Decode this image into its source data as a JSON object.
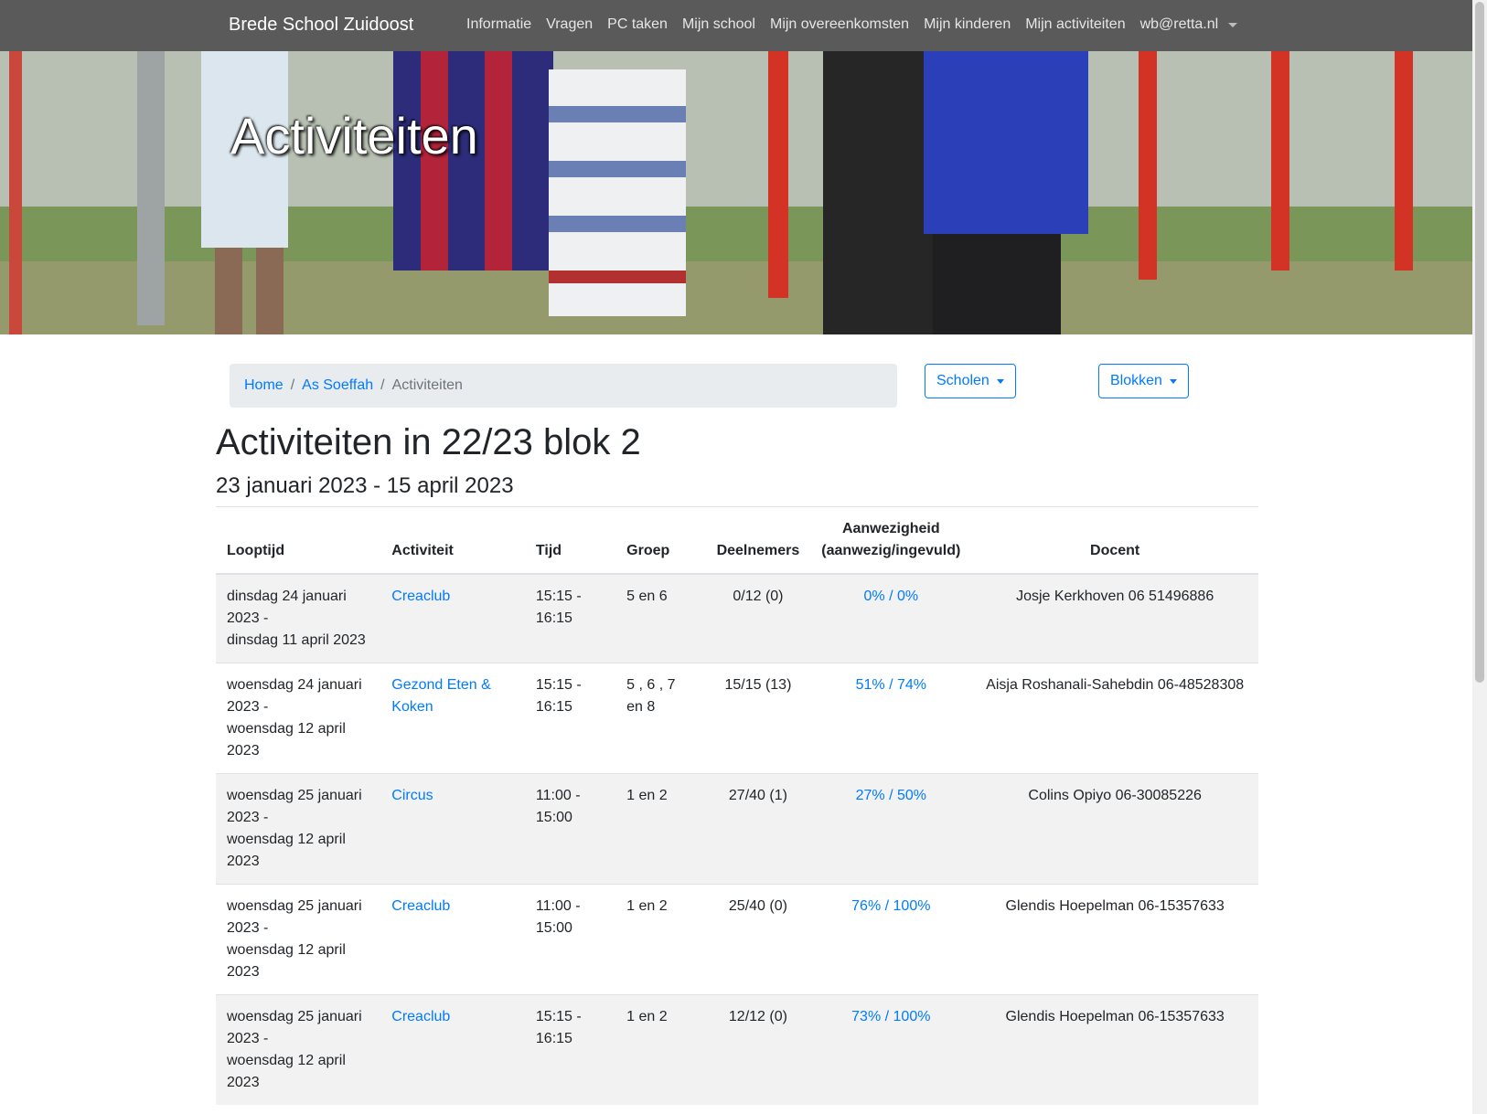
{
  "navbar": {
    "brand": "Brede School Zuidoost",
    "items": [
      "Informatie",
      "Vragen",
      "PC taken",
      "Mijn school",
      "Mijn overeenkomsten",
      "Mijn kinderen",
      "Mijn activiteiten",
      "wb@retta.nl"
    ]
  },
  "hero": {
    "title": "Activiteiten"
  },
  "breadcrumb": {
    "home": "Home",
    "school": "As Soeffah",
    "current": "Activiteiten"
  },
  "buttons": {
    "schools": "Scholen",
    "blocks": "Blokken"
  },
  "page": {
    "title": "Activiteiten in 22/23 blok 2",
    "subtitle": "23 januari 2023 - 15 april 2023"
  },
  "table": {
    "headers": {
      "looptijd": "Looptijd",
      "activiteit": "Activiteit",
      "tijd": "Tijd",
      "groep": "Groep",
      "deelnemers": "Deelnemers",
      "aanwezigheid_1": "Aanwezigheid",
      "aanwezigheid_2": "(aanwezig/ingevuld)",
      "docent": "Docent"
    },
    "rows": [
      {
        "start": "dinsdag 24 januari 2023 -",
        "end": "dinsdag 11 april 2023",
        "activity": "Creaclub",
        "time": "15:15 - 16:15",
        "group": "5 en 6",
        "participants": "0/12 (0)",
        "attendance": "0% / 0%",
        "teacher": "Josje Kerkhoven 06 51496886"
      },
      {
        "start": "woensdag 24 januari 2023 -",
        "end": "woensdag 12 april 2023",
        "activity": "Gezond Eten & Koken",
        "time": "15:15 - 16:15",
        "group": "5 , 6 , 7 en 8",
        "participants": "15/15 (13)",
        "attendance": "51% / 74%",
        "teacher": "Aisja Roshanali-Sahebdin 06-48528308"
      },
      {
        "start": "woensdag 25 januari 2023 -",
        "end": "woensdag 12 april 2023",
        "activity": "Circus",
        "time": "11:00 - 15:00",
        "group": "1 en 2",
        "participants": "27/40 (1)",
        "attendance": "27% / 50%",
        "teacher": "Colins Opiyo 06-30085226"
      },
      {
        "start": "woensdag 25 januari 2023 -",
        "end": "woensdag 12 april 2023",
        "activity": "Creaclub",
        "time": "11:00 - 15:00",
        "group": "1 en 2",
        "participants": "25/40 (0)",
        "attendance": "76% / 100%",
        "teacher": "Glendis Hoepelman 06-15357633"
      },
      {
        "start": "woensdag 25 januari 2023 -",
        "end": "woensdag 12 april 2023",
        "activity": "Creaclub",
        "time": "15:15 - 16:15",
        "group": "1 en 2",
        "participants": "12/12 (0)",
        "attendance": "73% / 100%",
        "teacher": "Glendis Hoepelman 06-15357633"
      }
    ]
  }
}
